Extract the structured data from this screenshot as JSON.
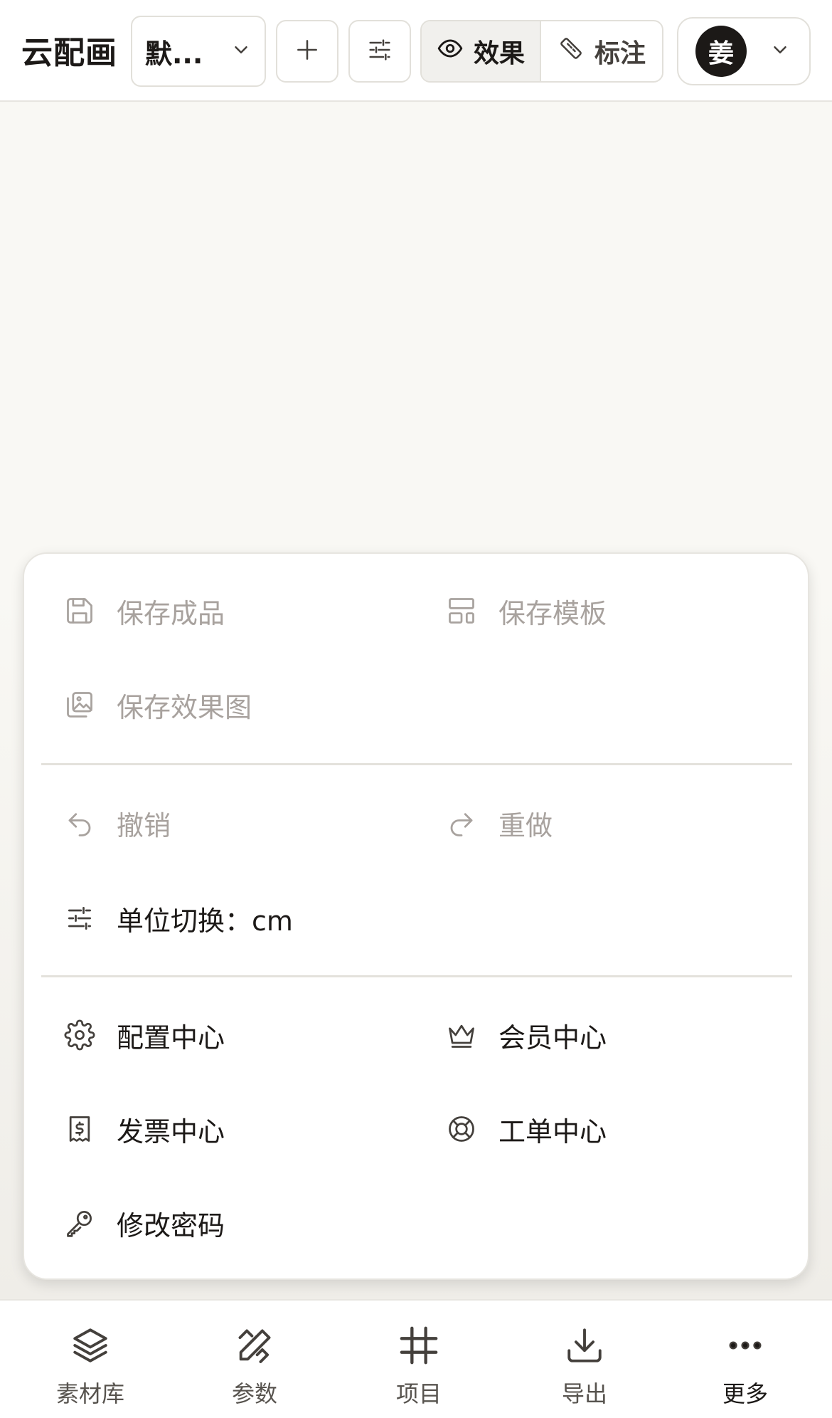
{
  "header": {
    "brand": "云配画",
    "project_select": "默...",
    "view_effect": "效果",
    "view_mark": "标注",
    "user_initial": "姜"
  },
  "menu": {
    "save_product": "保存成品",
    "save_template": "保存模板",
    "save_effect_image": "保存效果图",
    "undo": "撤销",
    "redo": "重做",
    "unit_switch": "单位切换：cm",
    "config_center": "配置中心",
    "member_center": "会员中心",
    "invoice_center": "发票中心",
    "ticket_center": "工单中心",
    "change_password": "修改密码"
  },
  "bottom_nav": {
    "materials": "素材库",
    "params": "参数",
    "project": "项目",
    "export": "导出",
    "more": "更多"
  }
}
